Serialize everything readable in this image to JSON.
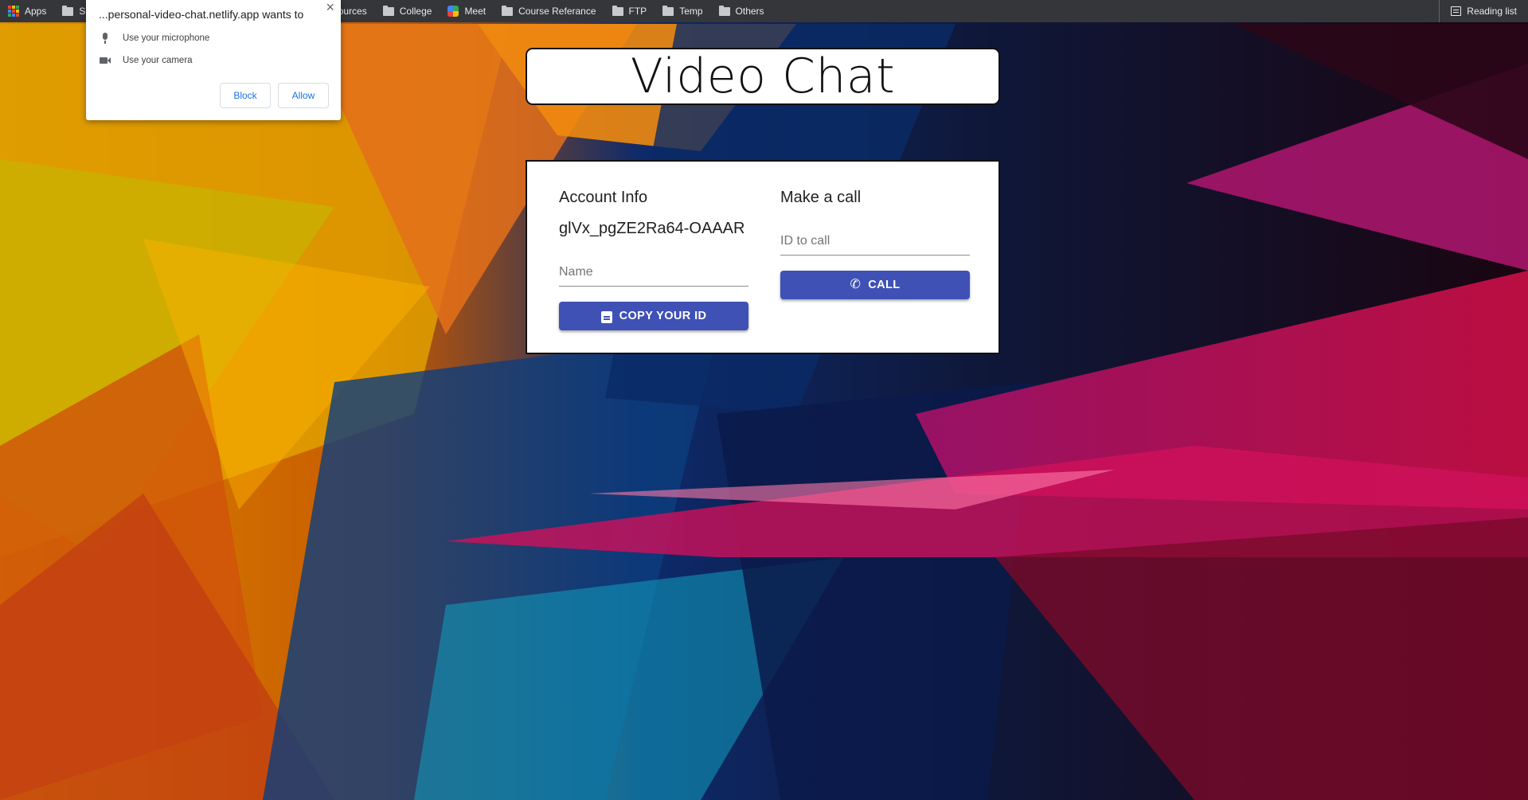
{
  "browser": {
    "bookmarks": [
      {
        "label": "Apps",
        "icon": "apps-grid-icon"
      },
      {
        "label": "S",
        "icon": "folder-icon"
      },
      {
        "label": "Resources",
        "icon": "folder-icon"
      },
      {
        "label": "College",
        "icon": "folder-icon"
      },
      {
        "label": "Meet",
        "icon": "meet-icon"
      },
      {
        "label": "Course Referance",
        "icon": "folder-icon"
      },
      {
        "label": "FTP",
        "icon": "folder-icon"
      },
      {
        "label": "Temp",
        "icon": "folder-icon"
      },
      {
        "label": "Others",
        "icon": "folder-icon"
      }
    ],
    "reading_list": "Reading list"
  },
  "permission_popup": {
    "title": "...personal-video-chat.netlify.app wants to",
    "close": "×",
    "items": [
      {
        "label": "Use your microphone",
        "icon": "microphone-icon"
      },
      {
        "label": "Use your camera",
        "icon": "camera-icon"
      }
    ],
    "block_label": "Block",
    "allow_label": "Allow"
  },
  "app": {
    "title": "Video Chat",
    "account": {
      "heading": "Account Info",
      "peer_id": "glVx_pgZE2Ra64-OAAAR",
      "name_placeholder": "Name",
      "copy_label": "COPY YOUR ID"
    },
    "call": {
      "heading": "Make a call",
      "id_placeholder": "ID to call",
      "call_label": "CALL"
    }
  },
  "colors": {
    "primary": "#3f51b5",
    "bookmarks_bar": "#35363a",
    "link_blue": "#1a73e8"
  }
}
